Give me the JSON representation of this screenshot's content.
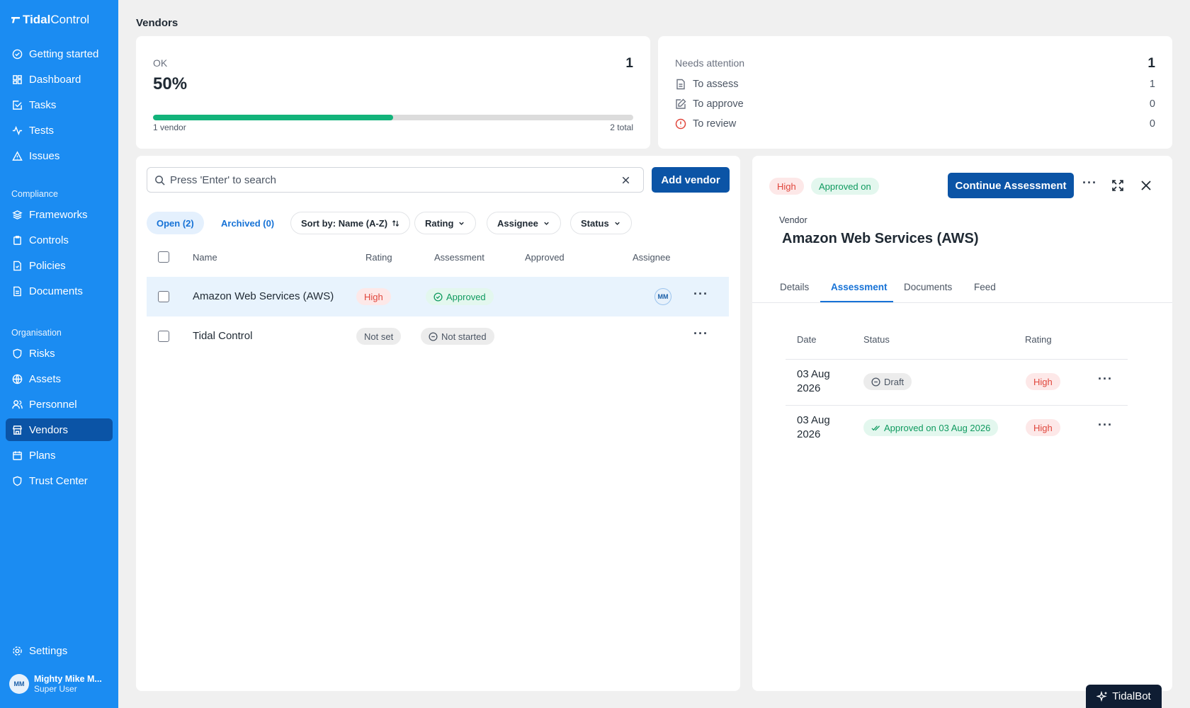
{
  "app": {
    "logo_bold": "Tidal",
    "logo_light": "Control"
  },
  "sidebar": {
    "items_top": [
      {
        "label": "Getting started",
        "icon": "check-circle-icon"
      },
      {
        "label": "Dashboard",
        "icon": "grid-icon"
      },
      {
        "label": "Tasks",
        "icon": "checkbox-icon"
      },
      {
        "label": "Tests",
        "icon": "activity-icon"
      },
      {
        "label": "Issues",
        "icon": "warning-icon"
      }
    ],
    "section_compliance": "Compliance",
    "items_compliance": [
      {
        "label": "Frameworks",
        "icon": "layers-icon"
      },
      {
        "label": "Controls",
        "icon": "clipboard-icon"
      },
      {
        "label": "Policies",
        "icon": "file-check-icon"
      },
      {
        "label": "Documents",
        "icon": "file-icon"
      }
    ],
    "section_org": "Organisation",
    "items_org": [
      {
        "label": "Risks",
        "icon": "shield-icon"
      },
      {
        "label": "Assets",
        "icon": "globe-icon"
      },
      {
        "label": "Personnel",
        "icon": "users-icon"
      },
      {
        "label": "Vendors",
        "icon": "store-icon",
        "active": true
      },
      {
        "label": "Plans",
        "icon": "calendar-icon"
      },
      {
        "label": "Trust Center",
        "icon": "shield-check-icon"
      }
    ],
    "settings": "Settings",
    "user": {
      "initials": "MM",
      "name": "Mighty Mike M...",
      "role": "Super User"
    }
  },
  "page": {
    "title": "Vendors"
  },
  "ok_card": {
    "label": "OK",
    "percent": "50%",
    "count": "1",
    "progress": 0.5,
    "left_caption": "1 vendor",
    "right_caption": "2 total"
  },
  "attention_card": {
    "label": "Needs attention",
    "count": "1",
    "rows": [
      {
        "label": "To assess",
        "value": "1",
        "icon": "file-icon"
      },
      {
        "label": "To approve",
        "value": "0",
        "icon": "pencil-icon"
      },
      {
        "label": "To review",
        "value": "0",
        "icon": "alert-circle-icon"
      }
    ]
  },
  "list": {
    "search_placeholder": "Press 'Enter' to search",
    "add_button": "Add vendor",
    "tabs": [
      "Open (2)",
      "Archived (0)"
    ],
    "sort": "Sort by: Name (A-Z)",
    "filters": [
      "Rating",
      "Assignee",
      "Status"
    ],
    "columns": [
      "Name",
      "Rating",
      "Assessment",
      "Approved",
      "Assignee"
    ],
    "rows": [
      {
        "name": "Amazon Web Services (AWS)",
        "rating": "High",
        "assessment": "Approved",
        "approved": "",
        "assignee": "MM"
      },
      {
        "name": "Tidal Control",
        "rating": "Not set",
        "assessment": "Not started",
        "approved": "",
        "assignee": ""
      }
    ]
  },
  "detail": {
    "badge_rating": "High",
    "badge_status": "Approved on",
    "continue_button": "Continue Assessment",
    "vendor_label": "Vendor",
    "vendor_name": "Amazon Web Services (AWS)",
    "tabs": [
      "Details",
      "Assessment",
      "Documents",
      "Feed"
    ],
    "active_tab": "Assessment",
    "columns": [
      "Date",
      "Status",
      "Rating"
    ],
    "rows": [
      {
        "date_line1": "03 Aug",
        "date_line2": "2026",
        "status": "Draft",
        "rating": "High"
      },
      {
        "date_line1": "03 Aug",
        "date_line2": "2026",
        "status": "Approved on 03 Aug 2026",
        "rating": "High"
      }
    ]
  },
  "tidalbot": "TidalBot"
}
